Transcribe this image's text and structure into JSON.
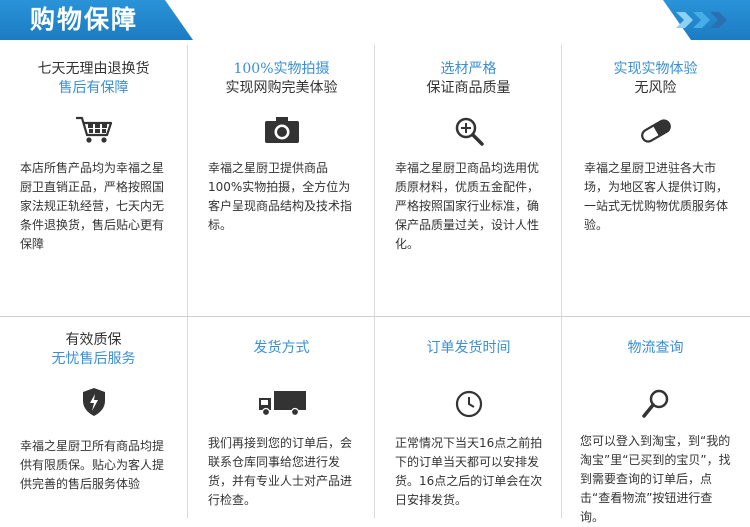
{
  "header": {
    "title": "购物保障"
  },
  "cells": [
    {
      "title1": "七天无理由退换货",
      "title2": "售后有保障",
      "icon": "shopping-cart-icon",
      "desc": "本店所售产品均为幸福之星厨卫直销正品，严格按照国家法规正轨经营，七天内无条件退换货，售后贴心更有保障"
    },
    {
      "title1": "100%实物拍摄",
      "title2": "实现网购完美体验",
      "icon": "camera-icon",
      "desc": "幸福之星厨卫提供商品100%实物拍摄，全方位为客户呈现商品结构及技术指标。"
    },
    {
      "title1": "选材严格",
      "title2": "保证商品质量",
      "icon": "magnifier-plus-icon",
      "desc": "幸福之星厨卫商品均选用优质原材料，优质五金配件，严格按照国家行业标准，确保产品质量过关，设计人性化。"
    },
    {
      "title1": "实现实物体验",
      "title2": "无风险",
      "icon": "capsule-icon",
      "desc": "幸福之星厨卫进驻各大市场，为地区客人提供订购，一站式无忧购物优质服务体验。"
    },
    {
      "title1": "有效质保",
      "title2": "无忧售后服务",
      "icon": "shield-icon",
      "desc": "幸福之星厨卫所有商品均提供有限质保。贴心为客人提供完善的售后服务体验"
    },
    {
      "title1": "发货方式",
      "title2": "",
      "icon": "truck-icon",
      "desc": "我们再接到您的订单后，会联系仓库同事给您进行发货，并有专业人士对产品进行检查。"
    },
    {
      "title1": "订单发货时间",
      "title2": "",
      "icon": "clock-icon",
      "desc": "正常情况下当天16点之前拍下的订单当天都可以安排发货。16点之后的订单会在次日安排发货。"
    },
    {
      "title1": "物流查询",
      "title2": "",
      "icon": "search-icon",
      "desc": "您可以登入到淘宝，到“我的淘宝”里“已买到的宝贝”，找到需要查询的订单后，点击“查看物流”按钮进行查询。"
    }
  ]
}
